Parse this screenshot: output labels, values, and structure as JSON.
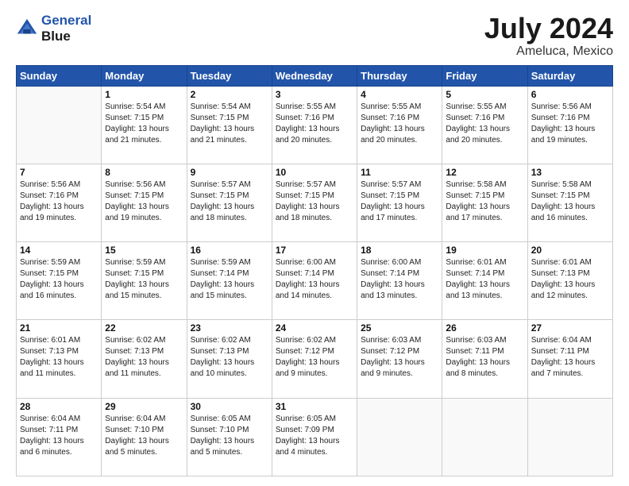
{
  "logo": {
    "line1": "General",
    "line2": "Blue"
  },
  "title": "July 2024",
  "subtitle": "Ameluca, Mexico",
  "days_of_week": [
    "Sunday",
    "Monday",
    "Tuesday",
    "Wednesday",
    "Thursday",
    "Friday",
    "Saturday"
  ],
  "weeks": [
    [
      {
        "day": "",
        "sunrise": "",
        "sunset": "",
        "daylight": ""
      },
      {
        "day": "1",
        "sunrise": "Sunrise: 5:54 AM",
        "sunset": "Sunset: 7:15 PM",
        "daylight": "Daylight: 13 hours and 21 minutes."
      },
      {
        "day": "2",
        "sunrise": "Sunrise: 5:54 AM",
        "sunset": "Sunset: 7:15 PM",
        "daylight": "Daylight: 13 hours and 21 minutes."
      },
      {
        "day": "3",
        "sunrise": "Sunrise: 5:55 AM",
        "sunset": "Sunset: 7:16 PM",
        "daylight": "Daylight: 13 hours and 20 minutes."
      },
      {
        "day": "4",
        "sunrise": "Sunrise: 5:55 AM",
        "sunset": "Sunset: 7:16 PM",
        "daylight": "Daylight: 13 hours and 20 minutes."
      },
      {
        "day": "5",
        "sunrise": "Sunrise: 5:55 AM",
        "sunset": "Sunset: 7:16 PM",
        "daylight": "Daylight: 13 hours and 20 minutes."
      },
      {
        "day": "6",
        "sunrise": "Sunrise: 5:56 AM",
        "sunset": "Sunset: 7:16 PM",
        "daylight": "Daylight: 13 hours and 19 minutes."
      }
    ],
    [
      {
        "day": "7",
        "sunrise": "Sunrise: 5:56 AM",
        "sunset": "Sunset: 7:16 PM",
        "daylight": "Daylight: 13 hours and 19 minutes."
      },
      {
        "day": "8",
        "sunrise": "Sunrise: 5:56 AM",
        "sunset": "Sunset: 7:15 PM",
        "daylight": "Daylight: 13 hours and 19 minutes."
      },
      {
        "day": "9",
        "sunrise": "Sunrise: 5:57 AM",
        "sunset": "Sunset: 7:15 PM",
        "daylight": "Daylight: 13 hours and 18 minutes."
      },
      {
        "day": "10",
        "sunrise": "Sunrise: 5:57 AM",
        "sunset": "Sunset: 7:15 PM",
        "daylight": "Daylight: 13 hours and 18 minutes."
      },
      {
        "day": "11",
        "sunrise": "Sunrise: 5:57 AM",
        "sunset": "Sunset: 7:15 PM",
        "daylight": "Daylight: 13 hours and 17 minutes."
      },
      {
        "day": "12",
        "sunrise": "Sunrise: 5:58 AM",
        "sunset": "Sunset: 7:15 PM",
        "daylight": "Daylight: 13 hours and 17 minutes."
      },
      {
        "day": "13",
        "sunrise": "Sunrise: 5:58 AM",
        "sunset": "Sunset: 7:15 PM",
        "daylight": "Daylight: 13 hours and 16 minutes."
      }
    ],
    [
      {
        "day": "14",
        "sunrise": "Sunrise: 5:59 AM",
        "sunset": "Sunset: 7:15 PM",
        "daylight": "Daylight: 13 hours and 16 minutes."
      },
      {
        "day": "15",
        "sunrise": "Sunrise: 5:59 AM",
        "sunset": "Sunset: 7:15 PM",
        "daylight": "Daylight: 13 hours and 15 minutes."
      },
      {
        "day": "16",
        "sunrise": "Sunrise: 5:59 AM",
        "sunset": "Sunset: 7:14 PM",
        "daylight": "Daylight: 13 hours and 15 minutes."
      },
      {
        "day": "17",
        "sunrise": "Sunrise: 6:00 AM",
        "sunset": "Sunset: 7:14 PM",
        "daylight": "Daylight: 13 hours and 14 minutes."
      },
      {
        "day": "18",
        "sunrise": "Sunrise: 6:00 AM",
        "sunset": "Sunset: 7:14 PM",
        "daylight": "Daylight: 13 hours and 13 minutes."
      },
      {
        "day": "19",
        "sunrise": "Sunrise: 6:01 AM",
        "sunset": "Sunset: 7:14 PM",
        "daylight": "Daylight: 13 hours and 13 minutes."
      },
      {
        "day": "20",
        "sunrise": "Sunrise: 6:01 AM",
        "sunset": "Sunset: 7:13 PM",
        "daylight": "Daylight: 13 hours and 12 minutes."
      }
    ],
    [
      {
        "day": "21",
        "sunrise": "Sunrise: 6:01 AM",
        "sunset": "Sunset: 7:13 PM",
        "daylight": "Daylight: 13 hours and 11 minutes."
      },
      {
        "day": "22",
        "sunrise": "Sunrise: 6:02 AM",
        "sunset": "Sunset: 7:13 PM",
        "daylight": "Daylight: 13 hours and 11 minutes."
      },
      {
        "day": "23",
        "sunrise": "Sunrise: 6:02 AM",
        "sunset": "Sunset: 7:13 PM",
        "daylight": "Daylight: 13 hours and 10 minutes."
      },
      {
        "day": "24",
        "sunrise": "Sunrise: 6:02 AM",
        "sunset": "Sunset: 7:12 PM",
        "daylight": "Daylight: 13 hours and 9 minutes."
      },
      {
        "day": "25",
        "sunrise": "Sunrise: 6:03 AM",
        "sunset": "Sunset: 7:12 PM",
        "daylight": "Daylight: 13 hours and 9 minutes."
      },
      {
        "day": "26",
        "sunrise": "Sunrise: 6:03 AM",
        "sunset": "Sunset: 7:11 PM",
        "daylight": "Daylight: 13 hours and 8 minutes."
      },
      {
        "day": "27",
        "sunrise": "Sunrise: 6:04 AM",
        "sunset": "Sunset: 7:11 PM",
        "daylight": "Daylight: 13 hours and 7 minutes."
      }
    ],
    [
      {
        "day": "28",
        "sunrise": "Sunrise: 6:04 AM",
        "sunset": "Sunset: 7:11 PM",
        "daylight": "Daylight: 13 hours and 6 minutes."
      },
      {
        "day": "29",
        "sunrise": "Sunrise: 6:04 AM",
        "sunset": "Sunset: 7:10 PM",
        "daylight": "Daylight: 13 hours and 5 minutes."
      },
      {
        "day": "30",
        "sunrise": "Sunrise: 6:05 AM",
        "sunset": "Sunset: 7:10 PM",
        "daylight": "Daylight: 13 hours and 5 minutes."
      },
      {
        "day": "31",
        "sunrise": "Sunrise: 6:05 AM",
        "sunset": "Sunset: 7:09 PM",
        "daylight": "Daylight: 13 hours and 4 minutes."
      },
      {
        "day": "",
        "sunrise": "",
        "sunset": "",
        "daylight": ""
      },
      {
        "day": "",
        "sunrise": "",
        "sunset": "",
        "daylight": ""
      },
      {
        "day": "",
        "sunrise": "",
        "sunset": "",
        "daylight": ""
      }
    ]
  ]
}
